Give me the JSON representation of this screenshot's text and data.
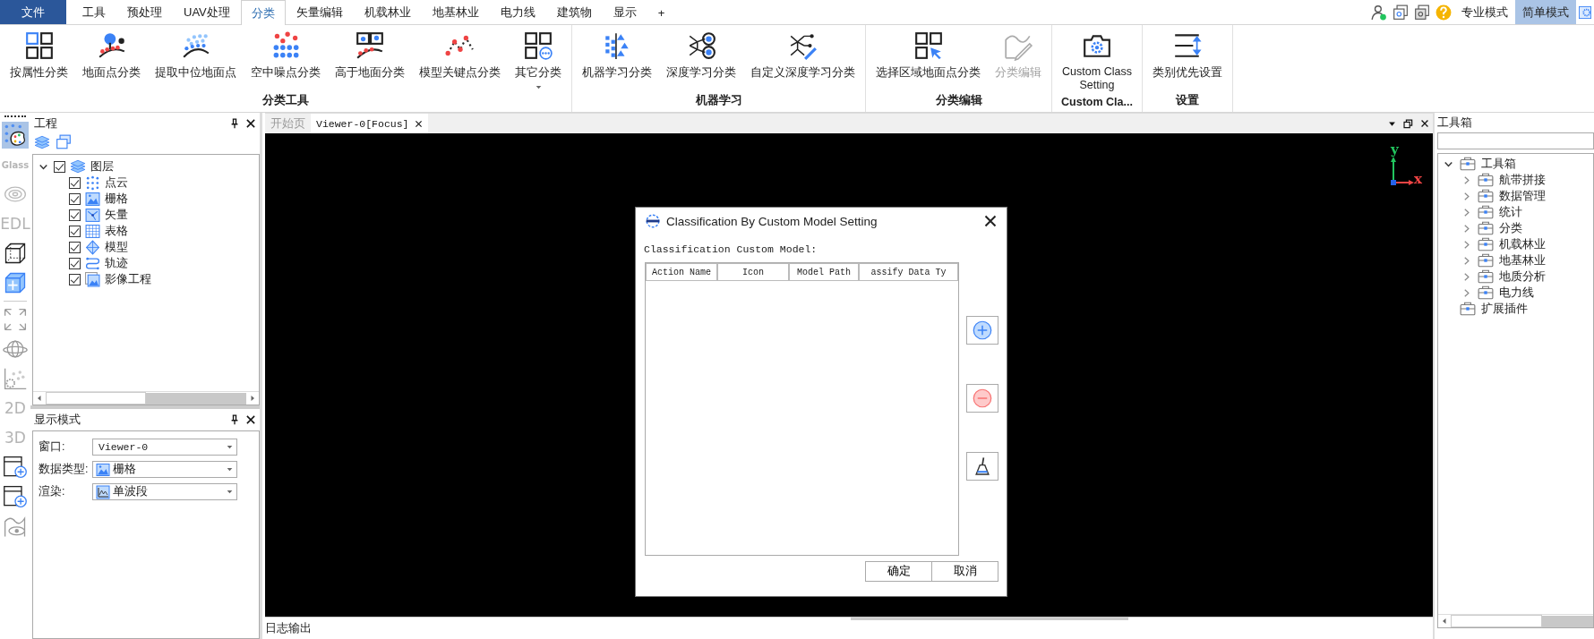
{
  "menu_tabs": [
    {
      "label": "文件",
      "kind": "file",
      "selected": false
    },
    {
      "label": "工具",
      "kind": "tab",
      "selected": false
    },
    {
      "label": "预处理",
      "kind": "tab",
      "selected": false
    },
    {
      "label": "UAV处理",
      "kind": "tab",
      "selected": false
    },
    {
      "label": "分类",
      "kind": "tab",
      "selected": true
    },
    {
      "label": "矢量编辑",
      "kind": "tab",
      "selected": false
    },
    {
      "label": "机载林业",
      "kind": "tab",
      "selected": false
    },
    {
      "label": "地基林业",
      "kind": "tab",
      "selected": false
    },
    {
      "label": "电力线",
      "kind": "tab",
      "selected": false
    },
    {
      "label": "建筑物",
      "kind": "tab",
      "selected": false
    },
    {
      "label": "显示",
      "kind": "tab",
      "selected": false
    },
    {
      "label": "+",
      "kind": "tab",
      "selected": false
    }
  ],
  "modes": [
    {
      "label": "专业模式",
      "selected": false
    },
    {
      "label": "简单模式",
      "selected": true
    }
  ],
  "ribbon": [
    {
      "title": "分类工具",
      "buttons": [
        {
          "label": "按属性分类",
          "disabled": false,
          "dropdown": false
        },
        {
          "label": "地面点分类",
          "disabled": false,
          "dropdown": false
        },
        {
          "label": "提取中位地面点",
          "disabled": false,
          "dropdown": false
        },
        {
          "label": "空中噪点分类",
          "disabled": false,
          "dropdown": false
        },
        {
          "label": "高于地面分类",
          "disabled": false,
          "dropdown": false
        },
        {
          "label": "模型关键点分类",
          "disabled": false,
          "dropdown": false
        },
        {
          "label": "其它分类",
          "disabled": false,
          "dropdown": true
        }
      ]
    },
    {
      "title": "机器学习",
      "buttons": [
        {
          "label": "机器学习分类",
          "disabled": false,
          "dropdown": false
        },
        {
          "label": "深度学习分类",
          "disabled": false,
          "dropdown": false
        },
        {
          "label": "自定义深度学习分类",
          "disabled": false,
          "dropdown": false
        }
      ]
    },
    {
      "title": "分类编辑",
      "buttons": [
        {
          "label": "选择区域地面点分类",
          "disabled": false,
          "dropdown": false
        },
        {
          "label": "分类编辑",
          "disabled": true,
          "dropdown": false
        }
      ]
    },
    {
      "title": "Custom Cla...",
      "buttons": [
        {
          "label": "Custom Class Setting",
          "disabled": false,
          "dropdown": false
        }
      ]
    },
    {
      "title": "设置",
      "buttons": [
        {
          "label": "类别优先设置",
          "disabled": false,
          "dropdown": false
        }
      ]
    }
  ],
  "left_toolbar": [
    {
      "kind": "icon",
      "selected": true
    },
    {
      "kind": "text",
      "label": "Glass",
      "selected": false
    },
    {
      "kind": "icon",
      "selected": false
    },
    {
      "kind": "text",
      "label": "EDL",
      "selected": false
    },
    {
      "kind": "icon",
      "selected": false
    },
    {
      "kind": "icon",
      "selected": false
    },
    {
      "kind": "divider"
    },
    {
      "kind": "icon",
      "selected": false
    },
    {
      "kind": "icon",
      "selected": false
    },
    {
      "kind": "icon",
      "selected": false
    },
    {
      "kind": "text",
      "label": "2D",
      "selected": false
    },
    {
      "kind": "text",
      "label": "3D",
      "selected": false
    },
    {
      "kind": "icon",
      "selected": false
    },
    {
      "kind": "icon",
      "selected": false
    },
    {
      "kind": "icon",
      "selected": false
    }
  ],
  "project_panel": {
    "title": "工程",
    "tree": [
      {
        "label": "图层",
        "checked": true,
        "expanded": true,
        "children": [
          {
            "label": "点云",
            "checked": true
          },
          {
            "label": "栅格",
            "checked": true
          },
          {
            "label": "矢量",
            "checked": true
          },
          {
            "label": "表格",
            "checked": true
          },
          {
            "label": "模型",
            "checked": true
          },
          {
            "label": "轨迹",
            "checked": true
          },
          {
            "label": "影像工程",
            "checked": true
          }
        ]
      }
    ]
  },
  "display_panel": {
    "title": "显示模式",
    "fields": [
      {
        "label": "窗口:",
        "value": "Viewer-0",
        "kind": "plain"
      },
      {
        "label": "数据类型:",
        "value": "栅格",
        "kind": "raster"
      },
      {
        "label": "渲染:",
        "value": "单波段",
        "kind": "band"
      }
    ]
  },
  "viewer": {
    "tabs": [
      {
        "label": "开始页",
        "selected": false,
        "closable": false
      },
      {
        "label": "Viewer-0[Focus]",
        "selected": true,
        "closable": true
      }
    ],
    "axis": {
      "y_label": "y",
      "x_label": "x"
    }
  },
  "dialog": {
    "title": "Classification By Custom Model Setting",
    "label": "Classification Custom Model:",
    "columns": [
      "Action Name",
      "Icon",
      "Model Path",
      "assify Data Ty"
    ],
    "buttons": [
      "确定",
      "取消"
    ]
  },
  "toolbox": {
    "title": "工具箱",
    "tree": [
      {
        "label": "工具箱",
        "expanded": true,
        "children": [
          {
            "label": "航带拼接",
            "expanded": false
          },
          {
            "label": "数据管理",
            "expanded": false
          },
          {
            "label": "统计",
            "expanded": false
          },
          {
            "label": "分类",
            "expanded": false
          },
          {
            "label": "机载林业",
            "expanded": false
          },
          {
            "label": "地基林业",
            "expanded": false
          },
          {
            "label": "地质分析",
            "expanded": false
          },
          {
            "label": "电力线",
            "expanded": false
          }
        ]
      },
      {
        "label": "扩展插件"
      }
    ]
  },
  "log": {
    "title": "日志输出"
  }
}
